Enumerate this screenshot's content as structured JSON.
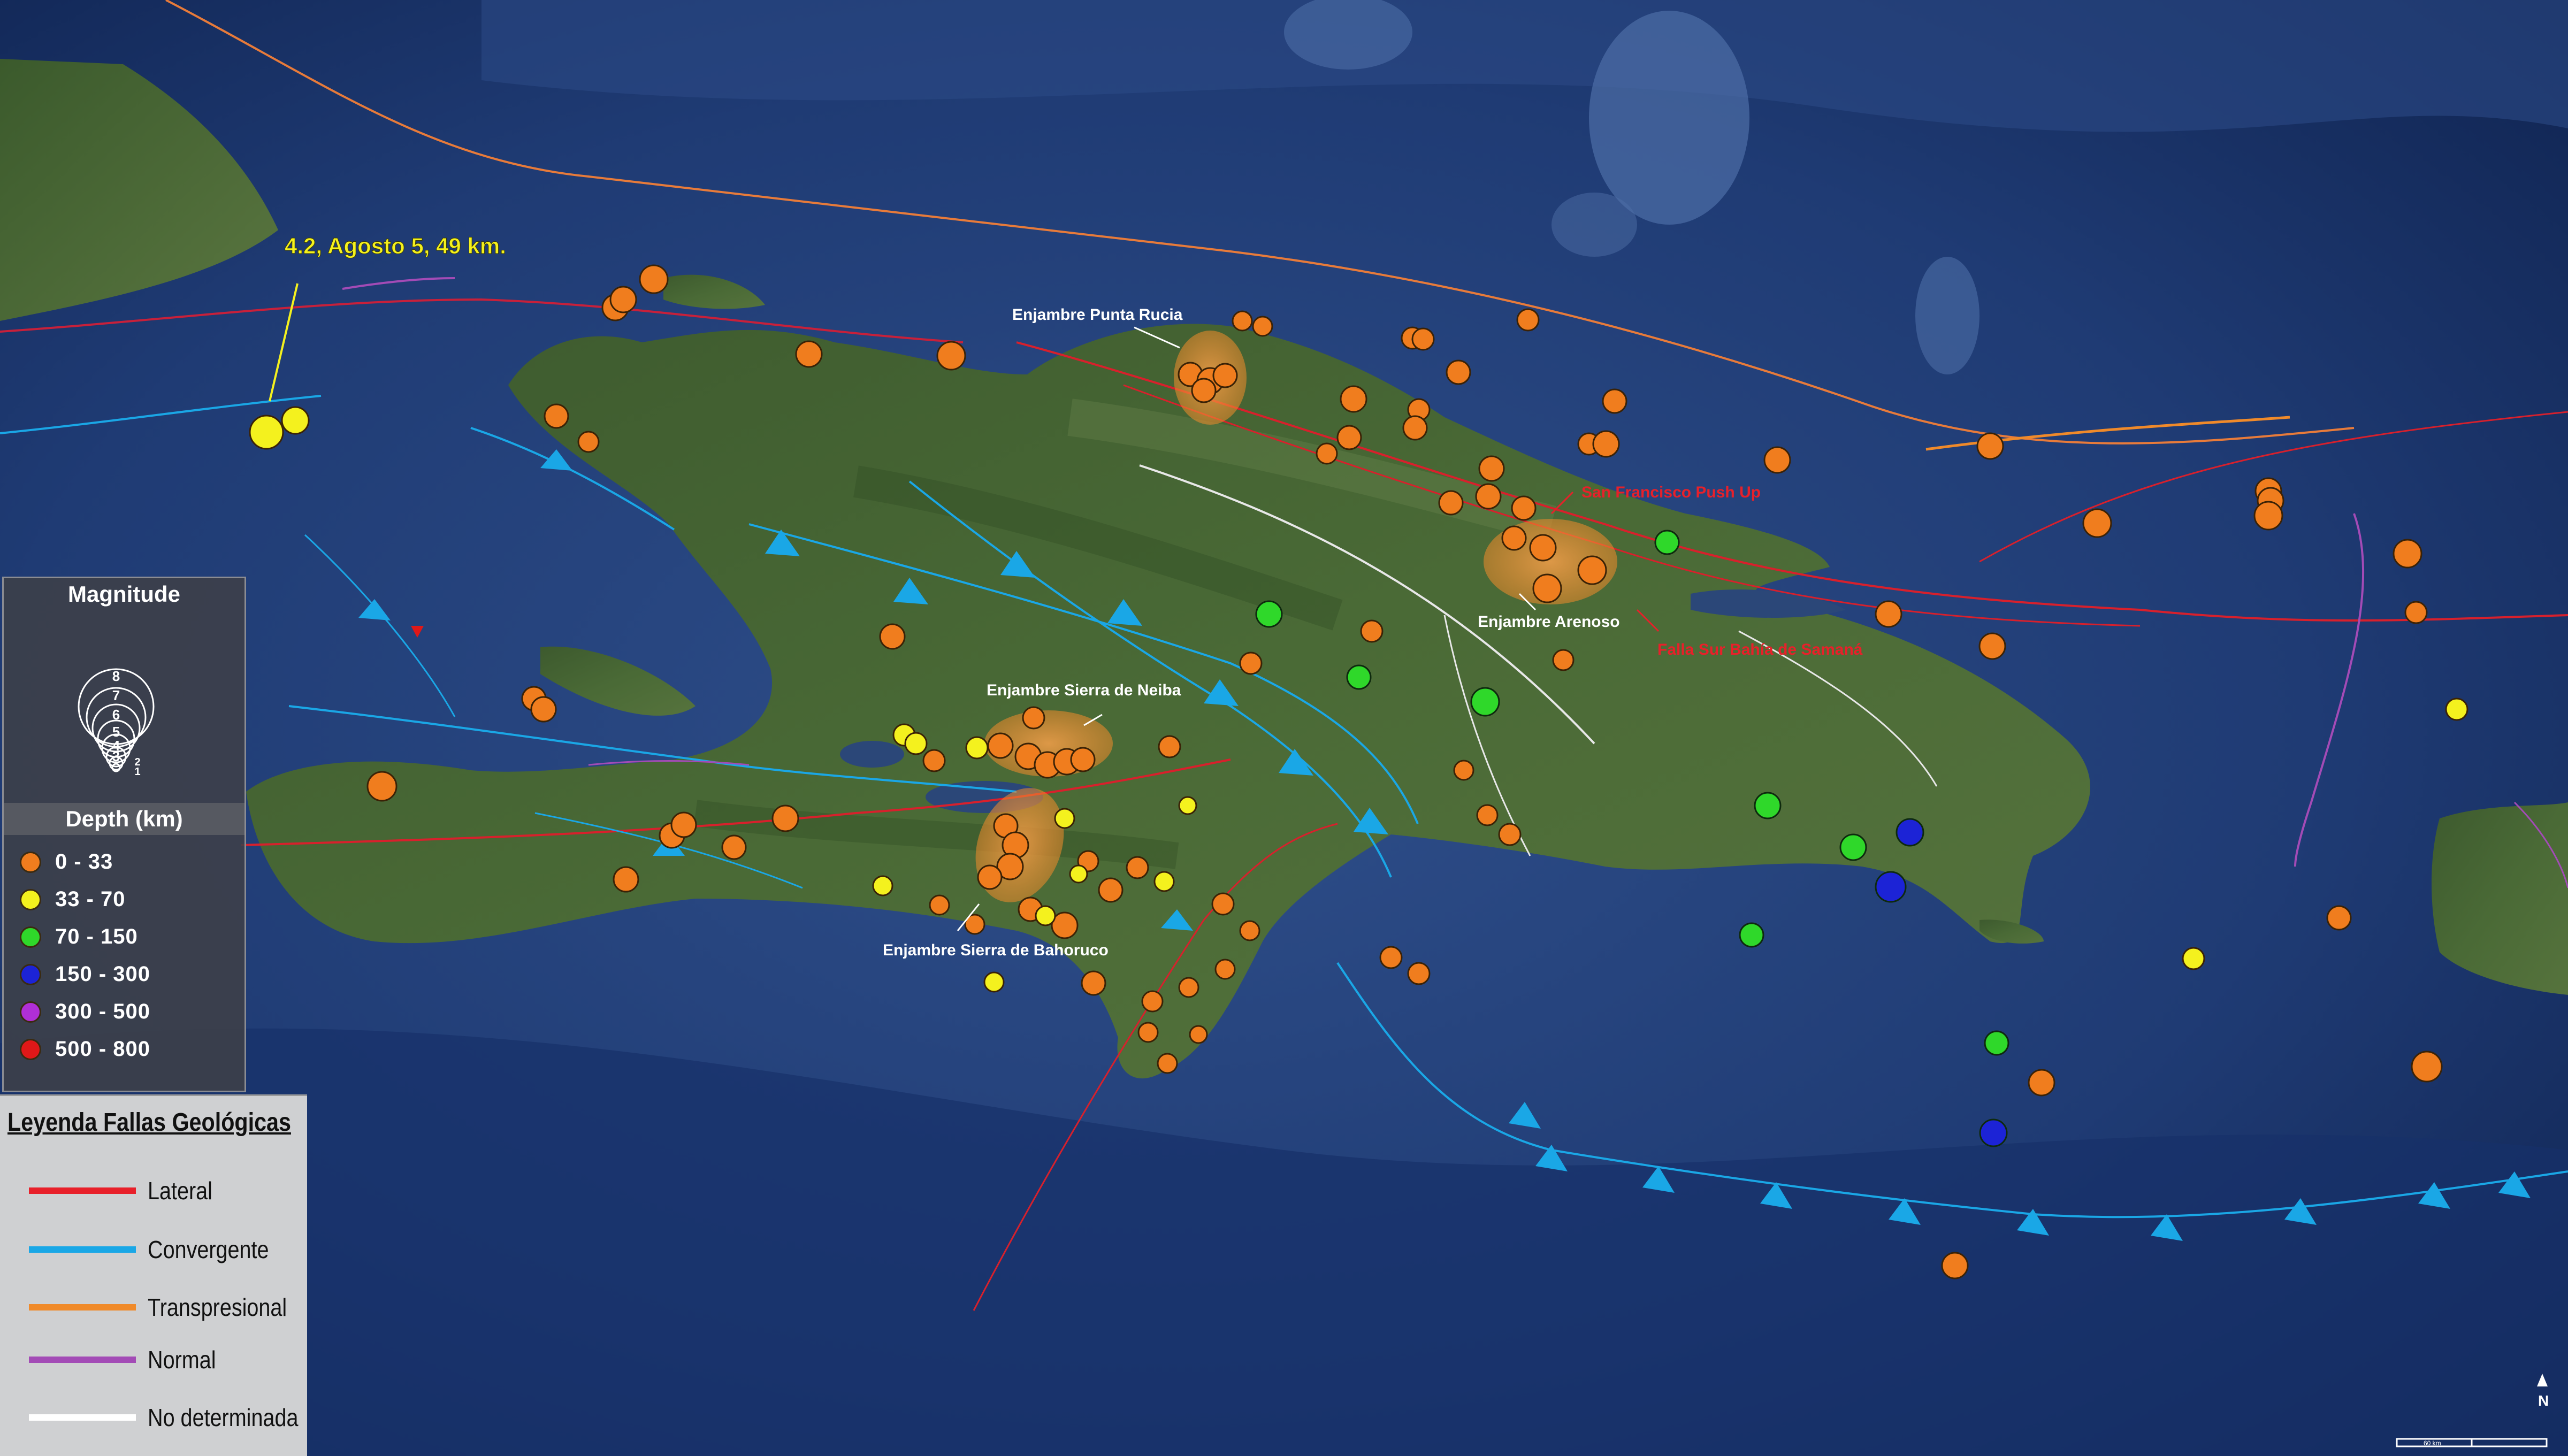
{
  "annotation_main": "4.2, Agosto 5, 49 km.",
  "swarms": {
    "punta_rucia": "Enjambre Punta Rucia",
    "arenoso": "Enjambre Arenoso",
    "neiba": "Enjambre Sierra de Neiba",
    "bahoruco": "Enjambre Sierra de Bahoruco"
  },
  "fault_labels": {
    "san_francisco": "San Francisco Push Up",
    "samana": "Falla Sur Bahía de Samaná"
  },
  "magnitude_legend": {
    "title": "Magnitude",
    "values": [
      "8",
      "7",
      "6",
      "5",
      "4",
      "3",
      "2",
      "1"
    ]
  },
  "depth_legend": {
    "title": "Depth (km)",
    "items": [
      {
        "label": "0 - 33",
        "color": "#f07d1e"
      },
      {
        "label": "33 - 70",
        "color": "#f4f11e"
      },
      {
        "label": "70 - 150",
        "color": "#2fd82a"
      },
      {
        "label": "150 - 300",
        "color": "#1c23d6"
      },
      {
        "label": "300 - 500",
        "color": "#b02fd6"
      },
      {
        "label": "500 - 800",
        "color": "#e01818"
      }
    ]
  },
  "fault_legend": {
    "title": "Leyenda Fallas Geológicas",
    "items": [
      {
        "label": "Lateral",
        "color": "#e8202a"
      },
      {
        "label": "Convergente",
        "color": "#1aa7e6"
      },
      {
        "label": "Transpresional",
        "color": "#f08a2a"
      },
      {
        "label": "Normal",
        "color": "#a34bb6"
      },
      {
        "label": "No determinada",
        "color": "#ffffff"
      }
    ]
  },
  "north_label": "N",
  "scale_label": "60 km",
  "earthquakes": [
    {
      "lon": -73.85,
      "lat": 19.42,
      "mag": 4.2,
      "depth": 49,
      "cls": "33-70"
    },
    {
      "lon": -73.8,
      "lat": 19.45,
      "mag": 3.6,
      "depth": 45,
      "cls": "33-70"
    },
    {
      "lon": -72.55,
      "lat": 20.05,
      "mag": 3.6,
      "depth": 10,
      "cls": "0-33"
    },
    {
      "lon": -72.65,
      "lat": 20.0,
      "mag": 3.8,
      "depth": 10,
      "cls": "0-33"
    },
    {
      "lon": -72.1,
      "lat": 19.9,
      "mag": 3.4,
      "depth": 10,
      "cls": "0-33"
    },
    {
      "lon": -71.0,
      "lat": 19.9,
      "mag": 3.8,
      "depth": 12,
      "cls": "0-33"
    },
    {
      "lon": -70.65,
      "lat": 19.88,
      "mag": 3.0,
      "depth": 10,
      "cls": "0-33"
    },
    {
      "lon": -70.8,
      "lat": 19.78,
      "mag": 3.6,
      "depth": 10,
      "cls": "0-33"
    },
    {
      "lon": -70.45,
      "lat": 19.62,
      "mag": 3.6,
      "depth": 10,
      "cls": "0-33"
    },
    {
      "lon": -70.1,
      "lat": 19.85,
      "mag": 3.2,
      "depth": 10,
      "cls": "0-33"
    },
    {
      "lon": -69.9,
      "lat": 19.78,
      "mag": 3.2,
      "depth": 10,
      "cls": "0-33"
    },
    {
      "lon": -69.95,
      "lat": 19.45,
      "mag": 3.6,
      "depth": 10,
      "cls": "0-33"
    },
    {
      "lon": -69.6,
      "lat": 19.25,
      "mag": 4.0,
      "depth": 10,
      "cls": "0-33"
    },
    {
      "lon": -69.0,
      "lat": 19.15,
      "mag": 3.4,
      "depth": 10,
      "cls": "0-33"
    },
    {
      "lon": -68.65,
      "lat": 19.38,
      "mag": 3.6,
      "depth": 10,
      "cls": "0-33"
    },
    {
      "lon": -68.1,
      "lat": 19.25,
      "mag": 3.8,
      "depth": 10,
      "cls": "0-33"
    },
    {
      "lon": -67.8,
      "lat": 19.32,
      "mag": 3.8,
      "depth": 10,
      "cls": "0-33"
    },
    {
      "lon": -67.2,
      "lat": 19.13,
      "mag": 3.4,
      "depth": 10,
      "cls": "0-33"
    },
    {
      "lon": -69.9,
      "lat": 19.17,
      "mag": 3.4,
      "depth": 95,
      "cls": "70-150"
    },
    {
      "lon": -70.6,
      "lat": 18.98,
      "mag": 3.6,
      "depth": 110,
      "cls": "70-150"
    },
    {
      "lon": -70.3,
      "lat": 18.88,
      "mag": 3.2,
      "depth": 90,
      "cls": "70-150"
    },
    {
      "lon": -70.05,
      "lat": 18.78,
      "mag": 3.6,
      "depth": 120,
      "cls": "70-150"
    },
    {
      "lon": -69.0,
      "lat": 18.48,
      "mag": 3.4,
      "depth": 85,
      "cls": "70-150"
    },
    {
      "lon": -68.9,
      "lat": 18.4,
      "mag": 3.4,
      "depth": 90,
      "cls": "70-150"
    },
    {
      "lon": -68.8,
      "lat": 18.45,
      "mag": 3.4,
      "depth": 165,
      "cls": "150-300"
    },
    {
      "lon": -68.9,
      "lat": 18.3,
      "mag": 3.8,
      "depth": 175,
      "cls": "150-300"
    },
    {
      "lon": -68.8,
      "lat": 17.75,
      "mag": 3.4,
      "depth": 160,
      "cls": "150-300"
    },
    {
      "lon": -69.0,
      "lat": 18.17,
      "mag": 3.2,
      "depth": 100,
      "cls": "70-150"
    },
    {
      "lon": -68.55,
      "lat": 17.92,
      "mag": 3.0,
      "depth": 95,
      "cls": "70-150"
    },
    {
      "lon": -71.5,
      "lat": 18.7,
      "mag": 3.6,
      "depth": 10,
      "cls": "0-33"
    },
    {
      "lon": -71.3,
      "lat": 18.55,
      "mag": 3.0,
      "depth": 50,
      "cls": "33-70"
    },
    {
      "lon": -71.4,
      "lat": 18.45,
      "mag": 3.2,
      "depth": 40,
      "cls": "33-70"
    },
    {
      "lon": -71.1,
      "lat": 18.3,
      "mag": 3.6,
      "depth": 10,
      "cls": "0-33"
    },
    {
      "lon": -70.9,
      "lat": 18.02,
      "mag": 3.2,
      "depth": 10,
      "cls": "0-33"
    },
    {
      "lon": -71.55,
      "lat": 17.95,
      "mag": 3.0,
      "depth": 55,
      "cls": "33-70"
    }
  ]
}
